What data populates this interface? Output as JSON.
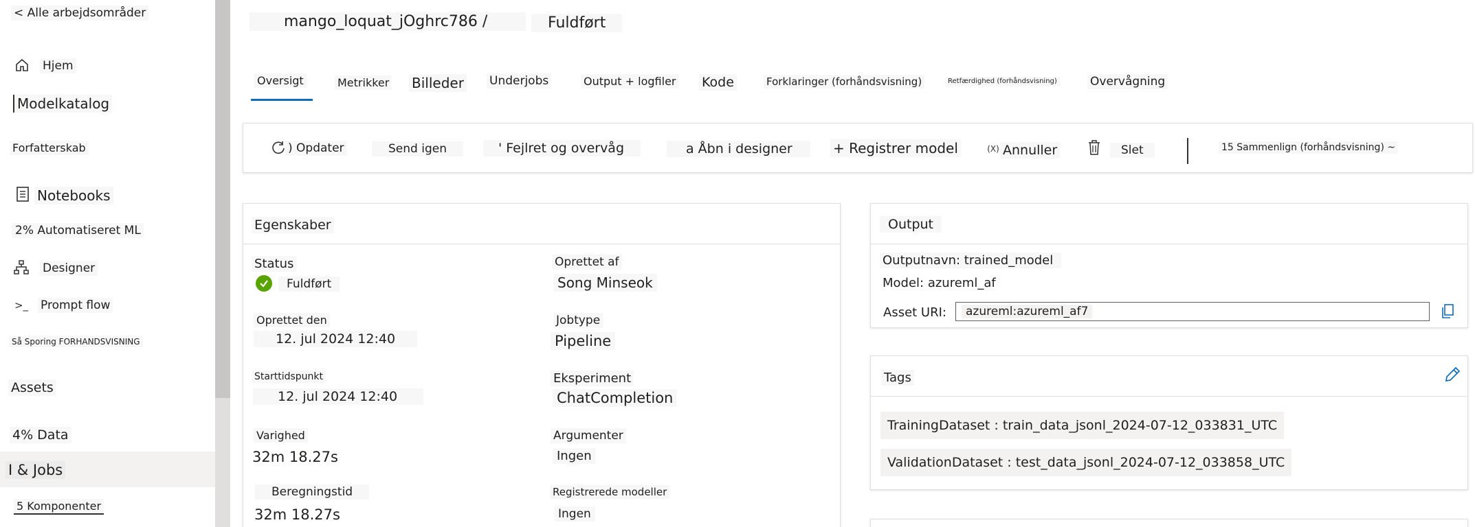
{
  "sidebar": {
    "back_link": "< Alle arbejdsområder",
    "home": "Hjem",
    "model_catalog": "Modelkatalog",
    "authoring_header": "Forfatterskab",
    "notebooks": "Notebooks",
    "automl": "2% Automatiseret ML",
    "designer": "Designer",
    "prompt_flow": "Prompt flow",
    "tracking": "Så Sporing FORHANDSVISNING",
    "assets_header": "Assets",
    "data": "4% Data",
    "jobs": "I & Jobs",
    "components": "5 Komponenter"
  },
  "header": {
    "job_name": "mango_loquat_jOghrc786 /",
    "status": "Fuldført"
  },
  "tabs": [
    "Oversigt",
    "Metrikker",
    "Billeder",
    "Underjobs",
    "Output + logfiler",
    "Kode",
    "Forklaringer (forhåndsvisning)",
    "Retfærdighed (forhåndsvisning)",
    "Overvågning"
  ],
  "toolbar": {
    "refresh": ") Opdater",
    "resubmit": "Send igen",
    "debug": "' Fejlret og overvåg",
    "open_designer": "a Åbn i designer",
    "register_model": "+ Registrer model",
    "cancel": "Annuller",
    "delete": "Slet",
    "compare": "15 Sammenlign (forhåndsvisning) ~"
  },
  "properties": {
    "title": "Egenskaber",
    "status_label": "Status",
    "status_value": "Fuldført",
    "created_by_label": "Oprettet af",
    "created_by_value": "Song Minseok",
    "created_on_label": "Oprettet den",
    "created_on_value": "12. jul 2024 12:40",
    "job_type_label": "Jobtype",
    "job_type_value": "Pipeline",
    "start_label": "Starttidspunkt",
    "start_value": "12. jul 2024 12:40",
    "experiment_label": "Eksperiment",
    "experiment_value": "ChatCompletion",
    "duration_label": "Varighed",
    "duration_value": "32m 18.27s",
    "arguments_label": "Argumenter",
    "arguments_value": "Ingen",
    "compute_label": "Beregningstid",
    "compute_value": "32m 18.27s",
    "registered_models_label": "Registrerede modeller",
    "registered_models_value": "Ingen"
  },
  "output": {
    "title": "Output",
    "output_name": "Outputnavn: trained_model",
    "model": "Model: azureml_af",
    "asset_uri_label": "Asset URI:",
    "asset_uri_value": "azureml:azureml_af7"
  },
  "tags": {
    "title": "Tags",
    "items": [
      "TrainingDataset : train_data_jsonl_2024-07-12_033831_UTC",
      "ValidationDataset : test_data_jsonl_2024-07-12_033858_UTC"
    ]
  },
  "colors": {
    "accent": "#0f6cbd",
    "success": "#57a300"
  }
}
